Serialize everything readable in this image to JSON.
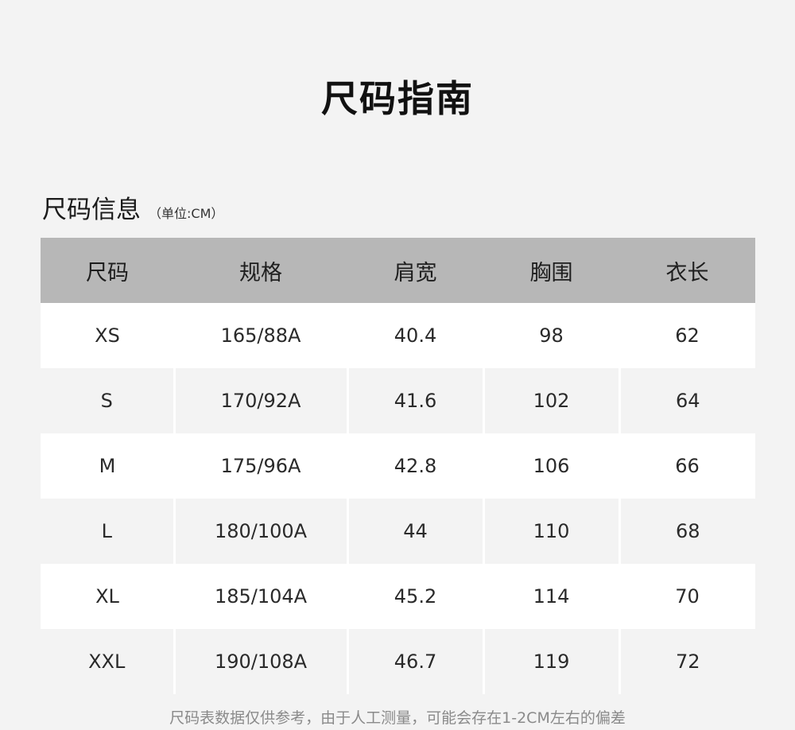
{
  "page": {
    "title": "尺码指南"
  },
  "section": {
    "title": "尺码信息",
    "unit": "（单位:CM）"
  },
  "table": {
    "headers": [
      "尺码",
      "规格",
      "肩宽",
      "胸围",
      "衣长"
    ],
    "rows": [
      [
        "XS",
        "165/88A",
        "40.4",
        "98",
        "62"
      ],
      [
        "S",
        "170/92A",
        "41.6",
        "102",
        "64"
      ],
      [
        "M",
        "175/96A",
        "42.8",
        "106",
        "66"
      ],
      [
        "L",
        "180/100A",
        "44",
        "110",
        "68"
      ],
      [
        "XL",
        "185/104A",
        "45.2",
        "114",
        "70"
      ],
      [
        "XXL",
        "190/108A",
        "46.7",
        "119",
        "72"
      ]
    ]
  },
  "footnote": "尺码表数据仅供参考，由于人工测量，可能会存在1-2CM左右的偏差",
  "colors": {
    "background": "#f3f3f3",
    "header_background": "#b7b7b7",
    "row_white": "#ffffff",
    "row_gray": "#f3f3f3"
  }
}
